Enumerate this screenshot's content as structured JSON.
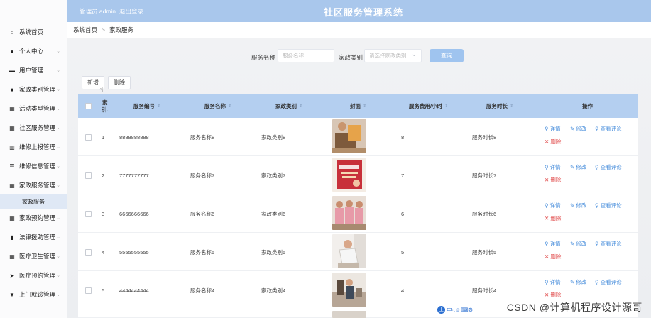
{
  "topbar": {
    "admin": "管理员 admin",
    "logout": "退出登录",
    "title": "社区服务管理系统"
  },
  "sidebar": {
    "items": [
      {
        "label": "系统首页",
        "icon": "home-icon",
        "glyph": "⌂",
        "chev": ""
      },
      {
        "label": "个人中心",
        "icon": "user-icon",
        "glyph": "●",
        "chev": "⌄"
      },
      {
        "label": "用户管理",
        "icon": "briefcase-icon",
        "glyph": "▬",
        "chev": "⌄"
      },
      {
        "label": "家政类别管理",
        "icon": "doc-icon",
        "glyph": "■",
        "chev": "⌄"
      },
      {
        "label": "活动类型管理",
        "icon": "grid-icon",
        "glyph": "▦",
        "chev": "⌄"
      },
      {
        "label": "社区服务管理",
        "icon": "grid-icon",
        "glyph": "▦",
        "chev": "⌄"
      },
      {
        "label": "维修上报管理",
        "icon": "table-icon",
        "glyph": "▥",
        "chev": "⌄"
      },
      {
        "label": "维修信息管理",
        "icon": "sliders-icon",
        "glyph": "☰",
        "chev": "⌄"
      },
      {
        "label": "家政服务管理",
        "icon": "grid-icon",
        "glyph": "▦",
        "chev": "⌄"
      },
      {
        "label": "家政预约管理",
        "icon": "grid-icon",
        "glyph": "▦",
        "chev": "⌄"
      },
      {
        "label": "法律援助管理",
        "icon": "chart-icon",
        "glyph": "▮",
        "chev": "⌄"
      },
      {
        "label": "医疗卫生管理",
        "icon": "grid-icon",
        "glyph": "▦",
        "chev": "⌄"
      },
      {
        "label": "医疗预约管理",
        "icon": "send-icon",
        "glyph": "➤",
        "chev": "⌄"
      },
      {
        "label": "上门就诊管理",
        "icon": "pin-icon",
        "glyph": "▼",
        "chev": "⌄"
      }
    ],
    "sub_item": "家政服务"
  },
  "breadcrumb": {
    "home": "系统首页",
    "sep": ">",
    "current": "家政服务"
  },
  "search": {
    "name_label": "服务名称",
    "name_placeholder": "服务名称",
    "type_label": "家政类别",
    "type_placeholder": "请选择家政类别",
    "query_button": "查询"
  },
  "toolbar": {
    "add": "新增",
    "delete": "删除"
  },
  "table": {
    "headers": {
      "index": "索",
      "index2": "引.",
      "code": "服务编号",
      "name": "服务名称",
      "type": "家政类别",
      "cover": "封面",
      "fee": "服务费用/小时",
      "duration": "服务时长",
      "ops": "操作"
    },
    "sort_glyph": "⇕",
    "actions": {
      "detail": "详情",
      "edit": "修改",
      "review": "查看评论",
      "remove": "删除"
    },
    "rows": [
      {
        "idx": "1",
        "code": "8888888888",
        "name": "服务名称8",
        "type": "家政类别8",
        "fee": "8",
        "duration": "服务时长8"
      },
      {
        "idx": "2",
        "code": "7777777777",
        "name": "服务名称7",
        "type": "家政类别7",
        "fee": "7",
        "duration": "服务时长7"
      },
      {
        "idx": "3",
        "code": "6666666666",
        "name": "服务名称6",
        "type": "家政类别6",
        "fee": "6",
        "duration": "服务时长6"
      },
      {
        "idx": "4",
        "code": "5555555555",
        "name": "服务名称5",
        "type": "家政类别5",
        "fee": "5",
        "duration": "服务时长5"
      },
      {
        "idx": "5",
        "code": "4444444444",
        "name": "服务名称4",
        "type": "家政类别4",
        "fee": "4",
        "duration": "服务时长4"
      }
    ]
  },
  "watermark": "CSDN @计算机程序设计源哥",
  "ime_glyphs": "中·,☺⌨⚙"
}
